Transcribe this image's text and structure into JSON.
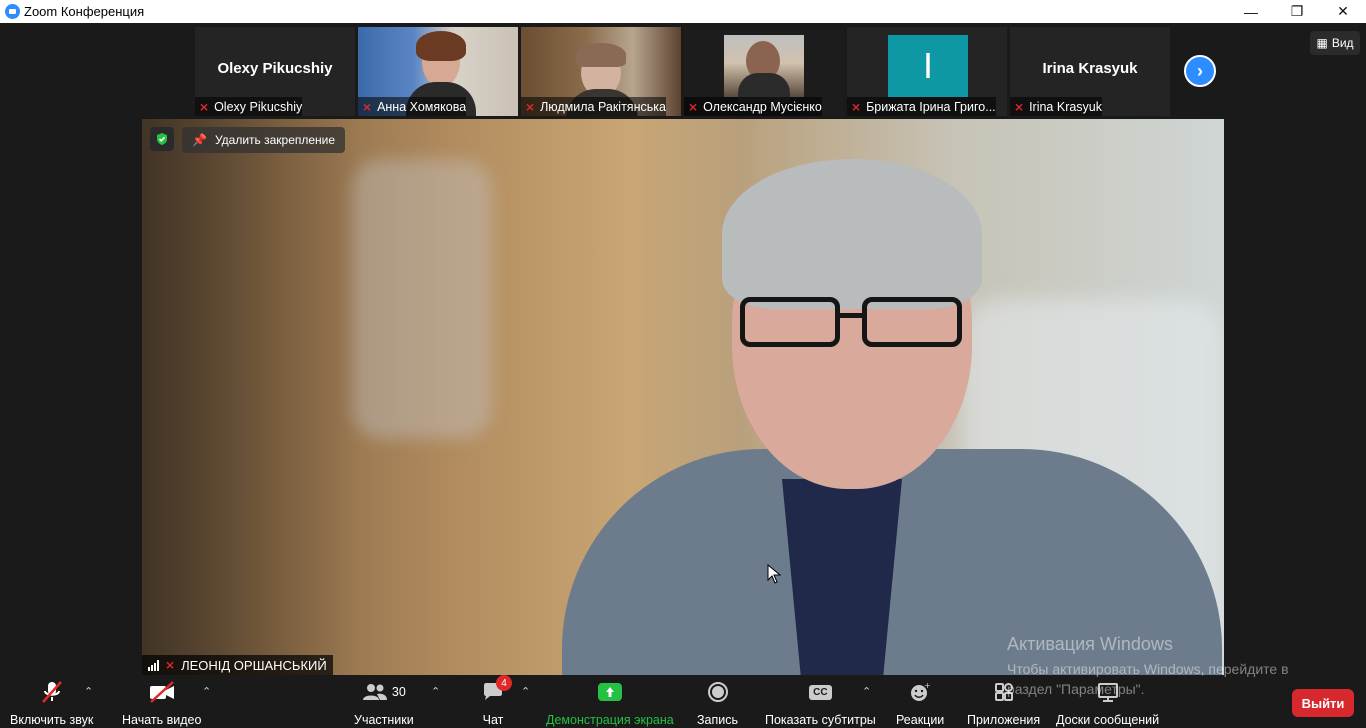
{
  "window": {
    "title": "Zoom Конференция",
    "minimize": "—",
    "restore": "❐",
    "close": "✕"
  },
  "view_button": {
    "label": "Вид",
    "icon": "grid-icon"
  },
  "participants_strip": [
    {
      "name": "Olexy Pikucshiy",
      "display_name": "Olexy Pikucshiy",
      "video": false,
      "muted": true
    },
    {
      "name": "Анна Хомякова",
      "video": true,
      "muted": true
    },
    {
      "name": "Людмила Ракітянська",
      "video": true,
      "muted": true
    },
    {
      "name": "Олександр Мусієнко",
      "video": true,
      "muted": true
    },
    {
      "name": "Брижата Ірина Григо...",
      "avatar_letter": "I",
      "avatar_color": "#0e98a3",
      "video": false,
      "muted": true
    },
    {
      "name": "Irina  Krasyuk",
      "display_name": "Irina  Krasyuk",
      "video": false,
      "muted": true
    }
  ],
  "next_page_icon": "chevron-right-icon",
  "main_video": {
    "unpin_label": "Удалить закрепление",
    "speaker_name": "ЛЕОНІД ОРШАНСЬКИЙ",
    "security_icon": "shield-check-icon"
  },
  "watermark": {
    "line1": "Активация Windows",
    "line2": "Чтобы активировать Windows, перейдите в раздел \"Параметры\"."
  },
  "toolbar": {
    "audio": "Включить звук",
    "video": "Начать видео",
    "participants": "Участники",
    "participants_count": "30",
    "chat": "Чат",
    "chat_badge": "4",
    "share": "Демонстрация экрана",
    "record": "Запись",
    "captions": "Показать субтитры",
    "captions_icon_text": "CC",
    "reactions": "Реакции",
    "apps": "Приложения",
    "whiteboards": "Доски сообщений",
    "leave": "Выйти"
  },
  "colors": {
    "accent": "#2d8cff",
    "share_green": "#24c142",
    "leave_red": "#d6282d",
    "mute_red": "#e02828"
  }
}
